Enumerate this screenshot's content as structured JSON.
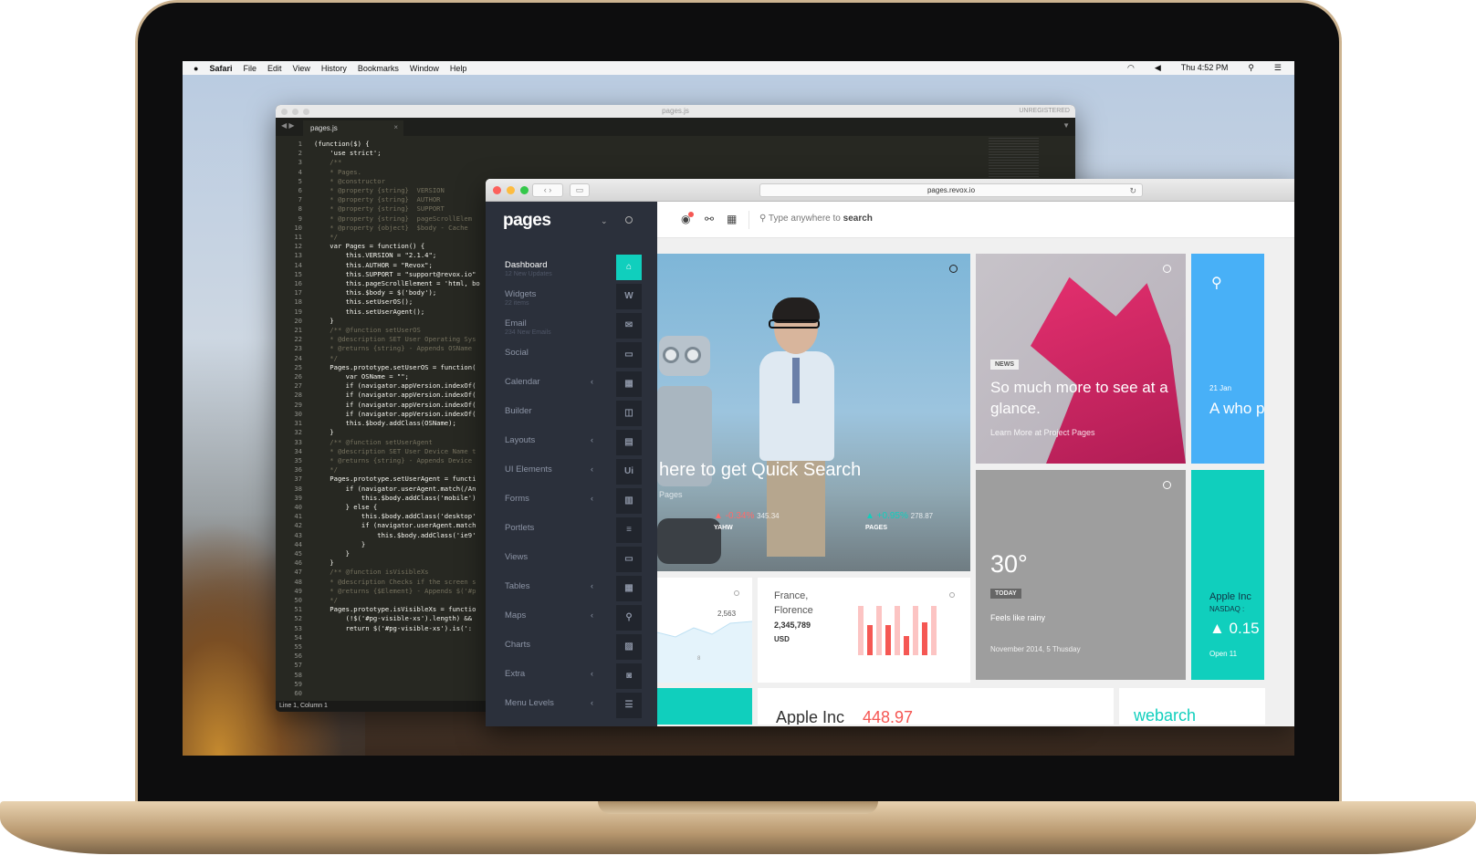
{
  "menubar": {
    "apple": "",
    "items": [
      "Safari",
      "File",
      "Edit",
      "View",
      "History",
      "Bookmarks",
      "Window",
      "Help"
    ],
    "clock": "Thu 4:52 PM"
  },
  "editor": {
    "title": "pages.js",
    "unregistered": "UNREGISTERED",
    "tab": "pages.js",
    "status": "Line 1, Column 1",
    "lines": [
      "(function($) {",
      "    'use strict';",
      "",
      "    /**",
      "    * Pages.",
      "    * @constructor",
      "    * @property {string}  VERSION",
      "    * @property {string}  AUTHOR",
      "    * @property {string}  SUPPORT",
      "    * @property {string}  pageScrollElem",
      "    * @property {object}  $body - Cache",
      "    */",
      "    var Pages = function() {",
      "        this.VERSION = \"2.1.4\";",
      "        this.AUTHOR = \"Revox\";",
      "        this.SUPPORT = \"support@revox.io\"",
      "",
      "        this.pageScrollElement = 'html, bo",
      "        this.$body = $('body');",
      "",
      "        this.setUserOS();",
      "        this.setUserAgent();",
      "    }",
      "",
      "    /** @function setUserOS",
      "    * @description SET User Operating Sys",
      "    * @returns {string} - Appends OSName",
      "    */",
      "    Pages.prototype.setUserOS = function(",
      "        var OSName = \"\";",
      "        if (navigator.appVersion.indexOf(",
      "        if (navigator.appVersion.indexOf(",
      "        if (navigator.appVersion.indexOf(",
      "        if (navigator.appVersion.indexOf(",
      "",
      "        this.$body.addClass(OSName);",
      "    }",
      "",
      "    /** @function setUserAgent",
      "    * @description SET User Device Name t",
      "    * @returns {string} - Appends Device",
      "    */",
      "    Pages.prototype.setUserAgent = functi",
      "        if (navigator.userAgent.match(/An",
      "            this.$body.addClass('mobile')",
      "        } else {",
      "            this.$body.addClass('desktop'",
      "            if (navigator.userAgent.match",
      "                this.$body.addClass('ie9'",
      "            }",
      "        }",
      "    }",
      "",
      "    /** @function isVisibleXs",
      "    * @description Checks if the screen s",
      "    * @returns {$Element} - Appends $('#p",
      "    */",
      "    Pages.prototype.isVisibleXs = functio",
      "        (!$('#pg-visible-xs').length) &&",
      "        return $('#pg-visible-xs').is(':"
    ]
  },
  "browser": {
    "url": "pages.revox.io",
    "brand": "pages",
    "search_placeholder": "Type anywhere to",
    "search_bold": "search",
    "menu": [
      {
        "label": "Dashboard",
        "sub": "12 New Updates",
        "icon": "⌂",
        "active": true
      },
      {
        "label": "Widgets",
        "sub": "22 items",
        "icon": "W"
      },
      {
        "label": "Email",
        "sub": "234 New Emails",
        "icon": "✉"
      },
      {
        "label": "Social",
        "sub": "",
        "icon": "▭"
      },
      {
        "label": "Calendar",
        "sub": "",
        "icon": "▦",
        "arrow": "‹"
      },
      {
        "label": "Builder",
        "sub": "",
        "icon": "◫"
      },
      {
        "label": "Layouts",
        "sub": "",
        "icon": "▤",
        "arrow": "‹"
      },
      {
        "label": "UI Elements",
        "sub": "",
        "icon": "Ui",
        "arrow": "‹"
      },
      {
        "label": "Forms",
        "sub": "",
        "icon": "▥",
        "arrow": "‹"
      },
      {
        "label": "Portlets",
        "sub": "",
        "icon": "≡"
      },
      {
        "label": "Views",
        "sub": "",
        "icon": "▭"
      },
      {
        "label": "Tables",
        "sub": "",
        "icon": "▦",
        "arrow": "‹"
      },
      {
        "label": "Maps",
        "sub": "",
        "icon": "⚲",
        "arrow": "‹"
      },
      {
        "label": "Charts",
        "sub": "",
        "icon": "▨"
      },
      {
        "label": "Extra",
        "sub": "",
        "icon": "◙",
        "arrow": "‹"
      },
      {
        "label": "Menu Levels",
        "sub": "",
        "icon": "☰",
        "arrow": "‹"
      }
    ],
    "hero": {
      "title": "here to get Quick Search",
      "subtitle": "Pages",
      "stock1": {
        "pct": "▲ -0.34%",
        "val": "345.34",
        "name": "YAHW"
      },
      "stock2": {
        "pct": "▲ +0.95%",
        "val": "278.87",
        "name": "PAGES"
      }
    },
    "news": {
      "tag": "NEWS",
      "title": "So much more to see at a glance.",
      "link": "Learn More at Project Pages"
    },
    "blue": {
      "date": "21 Jan",
      "title": "A who page"
    },
    "weather": {
      "deg": "30°",
      "tag": "TODAY",
      "desc": "Feels like rainy",
      "date": "November 2014, 5 Thusday"
    },
    "stocktile": {
      "name": "Apple Inc",
      "exchange": "NASDAQ :",
      "change": "▲ 0.15",
      "label": "Open  11"
    },
    "w1": {
      "n1": "2,563",
      "n2": "8"
    },
    "w2": {
      "city": "France, Florence",
      "num": "2,345,789",
      "cur": "USD"
    },
    "w4": {
      "title": "Apple Inc",
      "price": "448.97"
    },
    "w5": {
      "title": "webarch"
    }
  },
  "chart_data": {
    "type": "bar",
    "values": [
      0.9,
      0.55,
      0.9,
      0.55,
      0.9,
      0.35,
      0.9,
      0.6,
      0.9
    ]
  }
}
